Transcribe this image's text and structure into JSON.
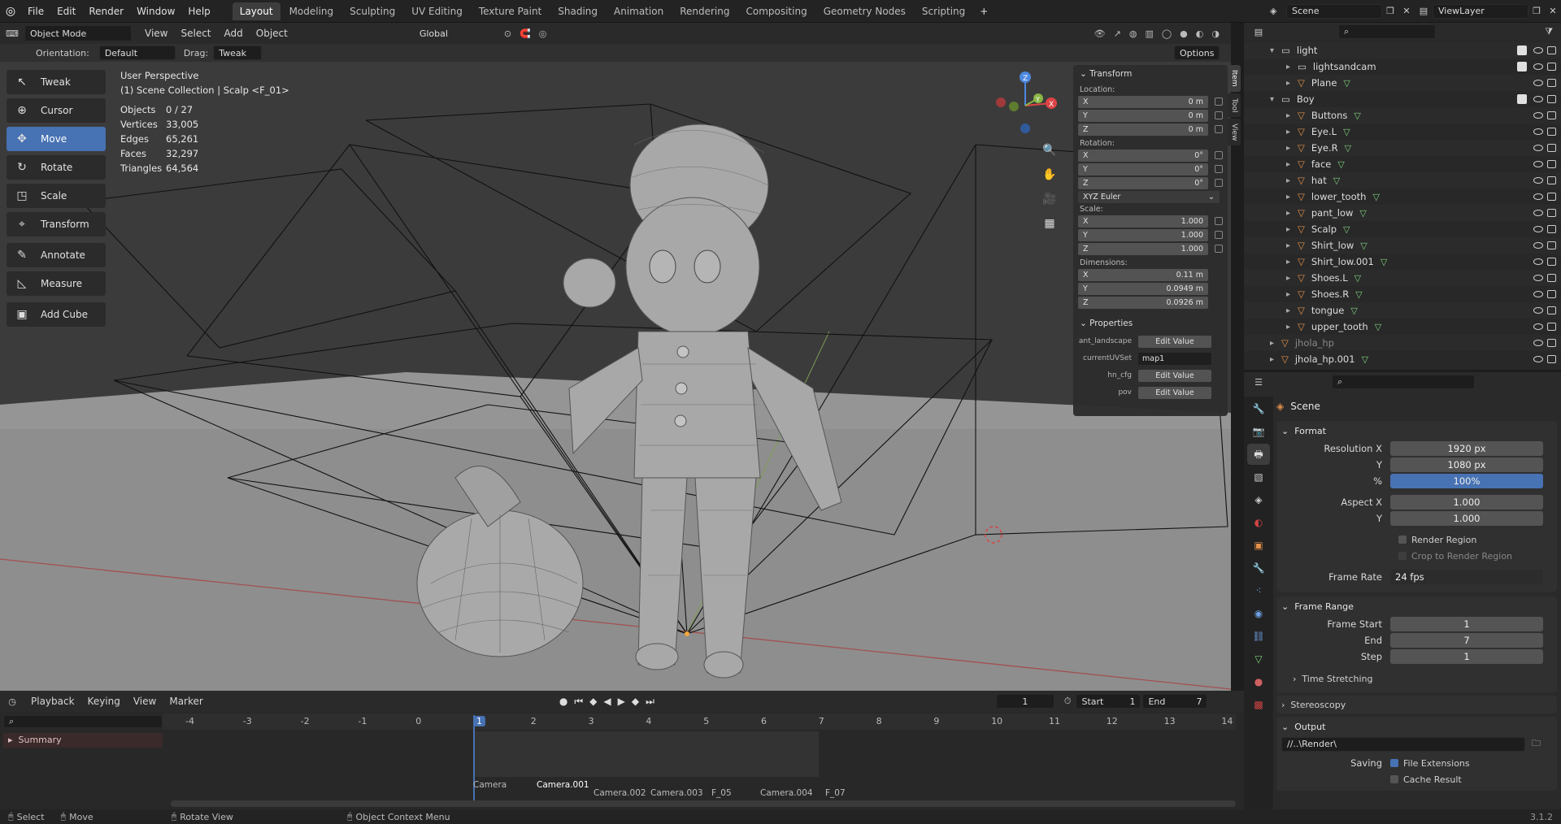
{
  "topbar": {
    "menus": [
      "File",
      "Edit",
      "Render",
      "Window",
      "Help"
    ],
    "workspaces": [
      "Layout",
      "Modeling",
      "Sculpting",
      "UV Editing",
      "Texture Paint",
      "Shading",
      "Animation",
      "Rendering",
      "Compositing",
      "Geometry Nodes",
      "Scripting"
    ],
    "active_workspace": "Layout",
    "add_tab": "+",
    "scene": "Scene",
    "view_layer": "ViewLayer"
  },
  "viewport": {
    "mode": "Object Mode",
    "menus": [
      "View",
      "Select",
      "Add",
      "Object"
    ],
    "transform_orientation": "Global",
    "orientation_label": "Orientation:",
    "orientation_value": "Default",
    "drag_label": "Drag:",
    "drag_value": "Tweak",
    "options": "Options",
    "perspective": "User Perspective",
    "collection_path": "(1) Scene Collection | Scalp <F_01>",
    "stats": [
      {
        "label": "Objects",
        "value": "0 / 27"
      },
      {
        "label": "Vertices",
        "value": "33,005"
      },
      {
        "label": "Edges",
        "value": "65,261"
      },
      {
        "label": "Faces",
        "value": "32,297"
      },
      {
        "label": "Triangles",
        "value": "64,564"
      }
    ],
    "tools": [
      {
        "label": "Tweak",
        "icon": "↖"
      },
      {
        "label": "Cursor",
        "icon": "⊕"
      },
      {
        "label": "Move",
        "icon": "✥"
      },
      {
        "label": "Rotate",
        "icon": "↻"
      },
      {
        "label": "Scale",
        "icon": "◳"
      },
      {
        "label": "Transform",
        "icon": "⌖"
      },
      {
        "label": "Annotate",
        "icon": "✎"
      },
      {
        "label": "Measure",
        "icon": "◺"
      },
      {
        "label": "Add Cube",
        "icon": "▣"
      }
    ],
    "active_tool": "Move",
    "gizmo": {
      "x": "X",
      "y": "Y",
      "z": "Z"
    }
  },
  "npanel": {
    "tabs": [
      "Item",
      "Tool",
      "View"
    ],
    "transform_title": "Transform",
    "location_label": "Location:",
    "location": [
      {
        "axis": "X",
        "value": "0 m"
      },
      {
        "axis": "Y",
        "value": "0 m"
      },
      {
        "axis": "Z",
        "value": "0 m"
      }
    ],
    "rotation_label": "Rotation:",
    "rotation": [
      {
        "axis": "X",
        "value": "0°"
      },
      {
        "axis": "Y",
        "value": "0°"
      },
      {
        "axis": "Z",
        "value": "0°"
      }
    ],
    "rotation_mode": "XYZ Euler",
    "scale_label": "Scale:",
    "scale": [
      {
        "axis": "X",
        "value": "1.000"
      },
      {
        "axis": "Y",
        "value": "1.000"
      },
      {
        "axis": "Z",
        "value": "1.000"
      }
    ],
    "dimensions_label": "Dimensions:",
    "dimensions": [
      {
        "axis": "X",
        "value": "0.11 m"
      },
      {
        "axis": "Y",
        "value": "0.0949 m"
      },
      {
        "axis": "Z",
        "value": "0.0926 m"
      }
    ],
    "properties_title": "Properties",
    "properties": [
      {
        "name": "ant_landscape",
        "value": "Edit Value"
      },
      {
        "name": "currentUVSet",
        "value": "map1"
      },
      {
        "name": "hn_cfg",
        "value": "Edit Value"
      },
      {
        "name": "pov",
        "value": "Edit Value"
      }
    ]
  },
  "timeline": {
    "menus": [
      "Playback",
      "Keying",
      "View",
      "Marker"
    ],
    "current_frame": "1",
    "start_label": "Start",
    "start": "1",
    "end_label": "End",
    "end": "7",
    "ruler": [
      "-4",
      "-3",
      "-2",
      "-1",
      "0",
      "1",
      "2",
      "3",
      "4",
      "5",
      "6",
      "7",
      "8",
      "9",
      "10",
      "11",
      "12",
      "13",
      "14"
    ],
    "summary": "Summary",
    "markers": [
      "Camera",
      "Camera.001",
      "Camera.002",
      "Camera.003",
      "F_05",
      "Camera.004",
      "F_07"
    ]
  },
  "statusbar": {
    "items": [
      "Select",
      "Move",
      "Rotate View",
      "Object Context Menu"
    ],
    "version": "3.1.2"
  },
  "outliner": {
    "rows": [
      {
        "name": "light",
        "indent": 1,
        "type": "collection",
        "expanded": true
      },
      {
        "name": "lightsandcam",
        "indent": 2,
        "type": "collection"
      },
      {
        "name": "Plane",
        "indent": 2,
        "type": "object"
      },
      {
        "name": "Boy",
        "indent": 1,
        "type": "collection",
        "expanded": true
      },
      {
        "name": "Buttons",
        "indent": 2,
        "type": "object"
      },
      {
        "name": "Eye.L",
        "indent": 2,
        "type": "object"
      },
      {
        "name": "Eye.R",
        "indent": 2,
        "type": "object"
      },
      {
        "name": "face",
        "indent": 2,
        "type": "object"
      },
      {
        "name": "hat",
        "indent": 2,
        "type": "object"
      },
      {
        "name": "lower_tooth",
        "indent": 2,
        "type": "object"
      },
      {
        "name": "pant_low",
        "indent": 2,
        "type": "object"
      },
      {
        "name": "Scalp",
        "indent": 2,
        "type": "object"
      },
      {
        "name": "Shirt_low",
        "indent": 2,
        "type": "object"
      },
      {
        "name": "Shirt_low.001",
        "indent": 2,
        "type": "object"
      },
      {
        "name": "Shoes.L",
        "indent": 2,
        "type": "object"
      },
      {
        "name": "Shoes.R",
        "indent": 2,
        "type": "object"
      },
      {
        "name": "tongue",
        "indent": 2,
        "type": "object"
      },
      {
        "name": "upper_tooth",
        "indent": 2,
        "type": "object"
      },
      {
        "name": "jhola_hp",
        "indent": 1,
        "type": "object",
        "dim": true
      },
      {
        "name": "jhola_hp.001",
        "indent": 1,
        "type": "object"
      }
    ]
  },
  "properties": {
    "context": "Scene",
    "format_title": "Format",
    "resolution_x_label": "Resolution X",
    "resolution_x": "1920 px",
    "resolution_y_label": "Y",
    "resolution_y": "1080 px",
    "percent_label": "%",
    "percent": "100%",
    "aspect_x_label": "Aspect X",
    "aspect_x": "1.000",
    "aspect_y_label": "Y",
    "aspect_y": "1.000",
    "render_region": "Render Region",
    "crop_region": "Crop to Render Region",
    "frame_rate_label": "Frame Rate",
    "frame_rate": "24 fps",
    "frame_range_title": "Frame Range",
    "frame_start_label": "Frame Start",
    "frame_start": "1",
    "end_label": "End",
    "end": "7",
    "step_label": "Step",
    "step": "1",
    "time_stretching": "Time Stretching",
    "stereoscopy": "Stereoscopy",
    "output_title": "Output",
    "output_path": "//..\\Render\\",
    "saving_label": "Saving",
    "file_extensions": "File Extensions",
    "cache_result": "Cache Result"
  },
  "colors": {
    "accent": "#4772b3",
    "object_orange": "#e3904a",
    "mesh_green": "#7fcf7f"
  }
}
